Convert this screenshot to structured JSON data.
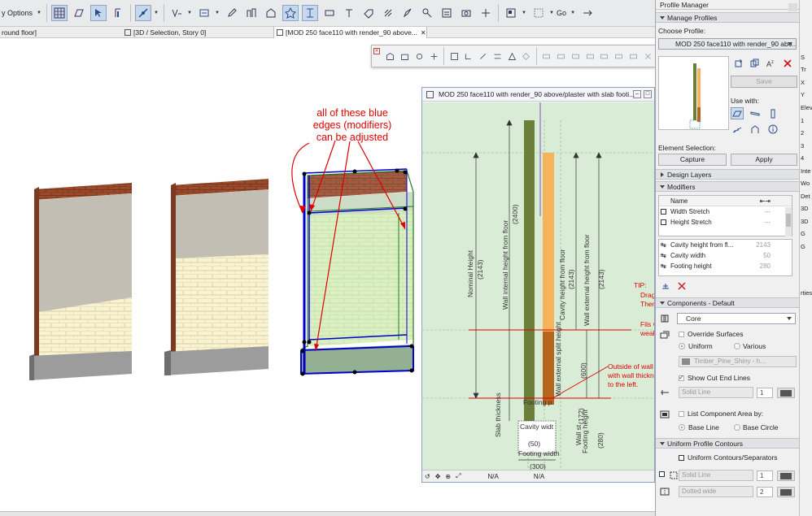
{
  "toolbar": {
    "options_label": "y Options",
    "go_label": "Go"
  },
  "tabs": [
    {
      "label": "round floor]"
    },
    {
      "label": "[3D / Selection, Story 0]"
    },
    {
      "label": "[MOD 250 face110 with render_90 above..."
    }
  ],
  "annotation": {
    "line1": "all of these blue",
    "line2": "edges (modifiers)",
    "line3": "can be adjusted"
  },
  "section_window": {
    "title": "MOD 250 face110 with render_90 above/plaster with slab footi...",
    "labels": {
      "nominal_height": "Nominal Height",
      "nominal_value": "(2143)",
      "wall_internal": "Wall internal height from floor",
      "wall_internal_value": "(2400)",
      "cavity_height": "Cavity height from floor",
      "cavity_height_value": "(2143)",
      "wall_external": "Wall external height from floor",
      "wall_external_value": "(2143)",
      "split_height": "Wall external split height",
      "split_value": "(600)",
      "slab_thickness": "Slab thickness",
      "wall_st": "Wall st",
      "cavity_width": "Cavity widt",
      "cw_value": "(50)",
      "footing_height": "Footing height",
      "fh_value": "(172)",
      "fh2_value": "(280)",
      "footing_width": "Footing width",
      "fw_value": "(300)",
      "footing_label": "Footing p",
      "tip1": "TIP:",
      "tip2": "Drag",
      "tip3": "Then",
      "fills1": "Fils v",
      "fills2": "weak",
      "outside1": "Outside of wall",
      "outside2": "with wall thickne",
      "outside3": "to the left."
    },
    "footer": {
      "na1": "N/A",
      "na2": "N/A"
    }
  },
  "profile_manager": {
    "title": "Profile Manager",
    "manage_profiles": "Manage Profiles",
    "choose_profile_label": "Choose Profile:",
    "choose_profile_value": "MOD 250 face110 with render_90 abo...",
    "save_label": "Save",
    "use_with_label": "Use with:",
    "element_selection_label": "Element Selection:",
    "capture_label": "Capture",
    "apply_label": "Apply",
    "design_layers": "Design Layers",
    "modifiers": "Modifiers",
    "mod_table": {
      "name_header": "Name",
      "rows1": [
        {
          "name": "Width Stretch",
          "value": "---"
        },
        {
          "name": "Height Stretch",
          "value": "---"
        }
      ],
      "rows2": [
        {
          "name": "Cavity height from fl...",
          "value": "2143"
        },
        {
          "name": "Cavity width",
          "value": "50"
        },
        {
          "name": "Footing height",
          "value": "280"
        }
      ]
    },
    "components_default": "Components - Default",
    "core_value": "Core",
    "override_surfaces": "Override Surfaces",
    "uniform_label": "Uniform",
    "various_label": "Various",
    "surface_value": "Timber_Pine_Shiny - h...",
    "show_cut_end_lines": "Show Cut End Lines",
    "solid_line_1": "Solid Line",
    "pen_1": "1",
    "list_component_area": "List Component Area by:",
    "base_line": "Base Line",
    "base_circle": "Base Circle",
    "uniform_profile_contours": "Uniform Profile Contours",
    "uniform_contours": "Uniform Contours/Separators",
    "solid_line_2": "Solid Line",
    "pen_2": "1",
    "dotted_wide": "Dotted wide",
    "pen_3": "2"
  },
  "right_panel": {
    "items": [
      "S",
      "Tr",
      "X",
      "Y",
      "Elev",
      "1",
      "2",
      "3",
      "4",
      "Inte",
      "Wo",
      "Det",
      "3D",
      "3D",
      "G",
      "G",
      "rties"
    ]
  },
  "colors": {
    "accent": "#0000cc",
    "section_bg": "#d9edd6",
    "annotation": "#e00000",
    "wall_green": "#6b8a3b",
    "wall_orange": "#f7b35a",
    "wall_brown": "#b5651d"
  }
}
